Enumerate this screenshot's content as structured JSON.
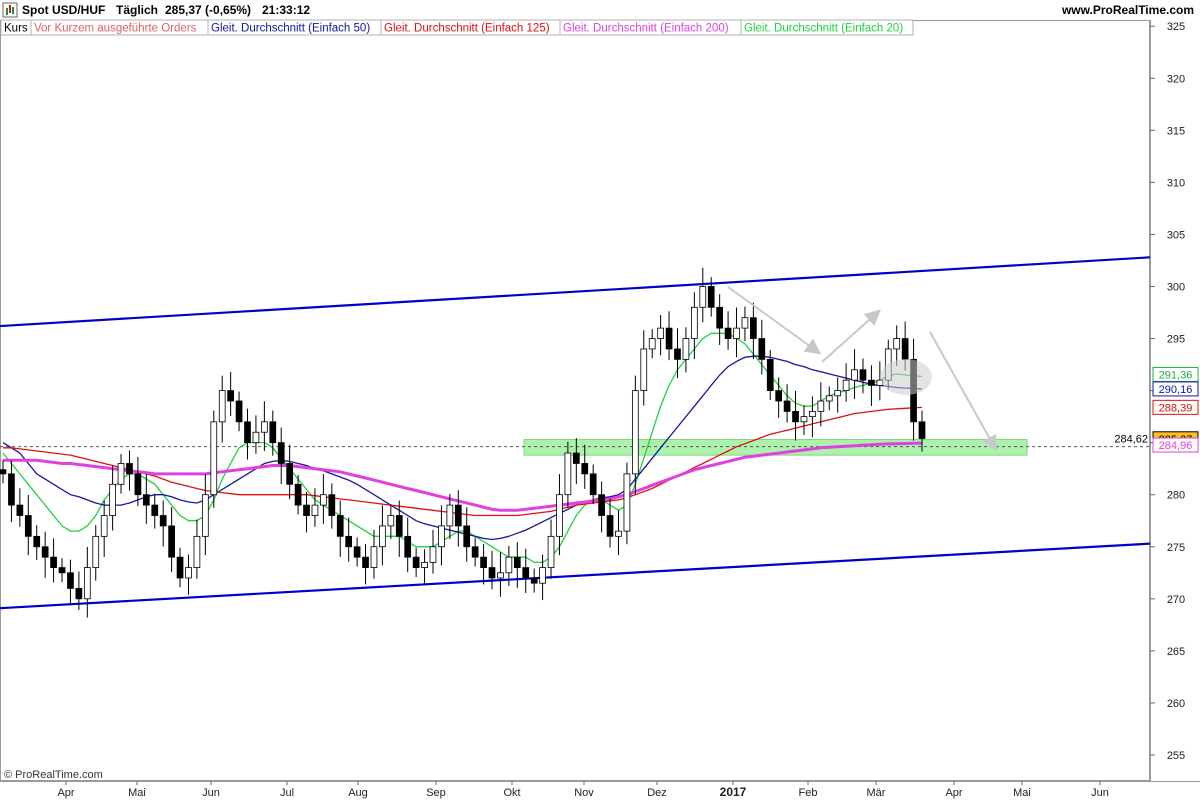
{
  "header": {
    "title": "Spot USD/HUF",
    "period": "Täglich",
    "quote": "285,37 (-0,65%)",
    "time": "21:33:12",
    "site": "www.ProRealTime.com"
  },
  "legend": [
    {
      "label": "Kurs",
      "color": "#000000"
    },
    {
      "label": "Vor Kurzem ausgeführte Orders",
      "color": "#e06060"
    },
    {
      "label": "Gleit. Durchschnitt (Einfach 50)",
      "color": "#1515a0"
    },
    {
      "label": "Gleit. Durchschnitt (Einfach 125)",
      "color": "#e01010"
    },
    {
      "label": "Gleit. Durchschnitt (Einfach 200)",
      "color": "#e040e0"
    },
    {
      "label": "Gleit. Durchschnitt (Einfach 20)",
      "color": "#20d040"
    }
  ],
  "copyright": "© ProRealTime.com",
  "price_labels": [
    {
      "value": "291,36",
      "price": 291.36,
      "color": "#20b040",
      "bg": "#ffffff"
    },
    {
      "value": "290,16",
      "price": 290.16,
      "color": "#1515a0",
      "bg": "#ffffff"
    },
    {
      "value": "288,39",
      "price": 288.39,
      "color": "#e01010",
      "bg": "#ffffff"
    },
    {
      "value": "285,37",
      "price": 285.37,
      "color": "#000000",
      "bg": "#ffc020"
    },
    {
      "value": "284,96",
      "price": 284.96,
      "color": "#e040e0",
      "bg": "#ffffff"
    }
  ],
  "dashed_level": {
    "value": "284,62",
    "price": 284.62
  },
  "chart_data": {
    "type": "candlestick",
    "title": "Spot USD/HUF",
    "y_ticks": [
      255,
      260,
      265,
      270,
      275,
      280,
      285,
      290,
      295,
      300,
      305,
      310,
      315,
      320,
      325
    ],
    "ylim": [
      252.5,
      325.5
    ],
    "x_ticks": [
      "Apr",
      "Mai",
      "Jun",
      "Jul",
      "Aug",
      "Sep",
      "Okt",
      "Nov",
      "Dez",
      "2017",
      "Feb",
      "Mär",
      "Apr",
      "Mai",
      "Jun"
    ],
    "bold_x_tick": "2017",
    "grid": false,
    "close_series": [
      282,
      279,
      278,
      276,
      275,
      274,
      273,
      272.5,
      271,
      270,
      273,
      276,
      278,
      281,
      283,
      282,
      280,
      279,
      278,
      277,
      274,
      272,
      273,
      276,
      280,
      287,
      290,
      289,
      287,
      285,
      286,
      287,
      285,
      283,
      281,
      279,
      278,
      279,
      280,
      278,
      276,
      275,
      274,
      273,
      275,
      277,
      278,
      276,
      274,
      273,
      273.5,
      275,
      277,
      279,
      277,
      275,
      274,
      273,
      272,
      272.5,
      274,
      273,
      272,
      271.5,
      273,
      276,
      280,
      284,
      283,
      282,
      280,
      278,
      276,
      276.5,
      282,
      290,
      294,
      295,
      296,
      294,
      293,
      295,
      298,
      300,
      298,
      296,
      295,
      296,
      297,
      295,
      293,
      290,
      289,
      288,
      287,
      287.5,
      288,
      289,
      289.5,
      290,
      291,
      292,
      291,
      290.5,
      291,
      294,
      295,
      293,
      287,
      285.4
    ],
    "ma_lines": [
      {
        "name": "Gleit. Durchschnitt (Einfach 20)",
        "color": "#20d040",
        "values": [
          284,
          283,
          282,
          281,
          280,
          279,
          278,
          277,
          276.5,
          276.5,
          277,
          278,
          279.5,
          280.5,
          281.5,
          282,
          282,
          281.5,
          281,
          280,
          279,
          278,
          277.5,
          277.5,
          278,
          279.5,
          281.5,
          283,
          284.5,
          285,
          285,
          285,
          284.5,
          283.5,
          282.5,
          281.5,
          280.5,
          279.5,
          279,
          278.5,
          278,
          277.5,
          277,
          276.5,
          276,
          276,
          276,
          276,
          275.5,
          275,
          275,
          275,
          275.5,
          276,
          276.5,
          276.5,
          276,
          275.5,
          275,
          274.5,
          274,
          274,
          274,
          273.5,
          273.5,
          274,
          275,
          276.5,
          278,
          279,
          279.5,
          279.5,
          279,
          278.5,
          279,
          281,
          283.5,
          286,
          288.5,
          290.5,
          292,
          293,
          294,
          295,
          295.5,
          295.5,
          295.5,
          295,
          294.5,
          293.5,
          292.5,
          291.5,
          290.5,
          289.5,
          288.8,
          288.5,
          288.5,
          289,
          289.5,
          289.8,
          290,
          290.3,
          290.5,
          290.7,
          291,
          291.4,
          291.6,
          291.5,
          291.4,
          291.36
        ]
      },
      {
        "name": "Gleit. Durchschnitt (Einfach 50)",
        "color": "#1515a0",
        "values": [
          285,
          284.5,
          284,
          283,
          282,
          281.5,
          281,
          280.5,
          280,
          279.8,
          279.5,
          279.2,
          279,
          279,
          279,
          279.2,
          279.5,
          279.8,
          280,
          280,
          279.8,
          279.5,
          279.3,
          279.2,
          279.5,
          280,
          280.5,
          281,
          281.5,
          282,
          282.5,
          283,
          283.2,
          283.3,
          283.2,
          283,
          282.8,
          282.5,
          282.3,
          282,
          281.7,
          281.4,
          281,
          280.5,
          280,
          279.5,
          279,
          278.5,
          278,
          277.5,
          277.2,
          277,
          276.8,
          276.6,
          276.4,
          276.2,
          276,
          275.8,
          275.7,
          275.8,
          276,
          276.3,
          276.6,
          277,
          277.4,
          277.8,
          278.2,
          278.6,
          279,
          279.3,
          279.5,
          279.7,
          279.8,
          280,
          280.5,
          281.5,
          282.5,
          283.5,
          284.5,
          285.5,
          286.5,
          287.5,
          288.5,
          289.5,
          290.5,
          291.5,
          292.3,
          292.8,
          293.2,
          293.3,
          293.3,
          293.2,
          293,
          292.8,
          292.5,
          292.3,
          292,
          291.8,
          291.6,
          291.4,
          291.2,
          291,
          290.8,
          290.6,
          290.5,
          290.4,
          290.3,
          290.25,
          290.2,
          290.16
        ]
      },
      {
        "name": "Gleit. Durchschnitt (Einfach 125)",
        "color": "#e01010",
        "values": [
          284.5,
          284.5,
          284.4,
          284.3,
          284.2,
          284.1,
          284,
          283.9,
          283.8,
          283.6,
          283.4,
          283.2,
          283,
          282.8,
          282.6,
          282.4,
          282.2,
          282,
          281.8,
          281.5,
          281.2,
          281,
          280.8,
          280.6,
          280.4,
          280.3,
          280.2,
          280.1,
          280,
          280,
          280,
          280,
          280,
          280,
          280,
          280,
          280,
          279.9,
          279.8,
          279.7,
          279.6,
          279.5,
          279.4,
          279.3,
          279.2,
          279.1,
          279,
          278.9,
          278.8,
          278.7,
          278.6,
          278.5,
          278.4,
          278.3,
          278.2,
          278.1,
          278,
          278,
          278,
          278,
          278,
          278,
          278.1,
          278.2,
          278.3,
          278.4,
          278.6,
          278.8,
          279,
          279.1,
          279.2,
          279.3,
          279.4,
          279.5,
          279.7,
          280,
          280.3,
          280.6,
          281,
          281.4,
          281.8,
          282.2,
          282.6,
          283,
          283.4,
          283.8,
          284.2,
          284.6,
          284.9,
          285.2,
          285.5,
          285.8,
          286,
          286.2,
          286.4,
          286.6,
          286.8,
          287,
          287.2,
          287.4,
          287.6,
          287.8,
          287.9,
          288,
          288.1,
          288.2,
          288.25,
          288.3,
          288.35,
          288.39
        ]
      },
      {
        "name": "Gleit. Durchschnitt (Einfach 200)",
        "color": "#e040e0",
        "values": [
          283.3,
          283.3,
          283.3,
          283.3,
          283.3,
          283.2,
          283.1,
          283,
          283,
          282.9,
          282.8,
          282.7,
          282.6,
          282.5,
          282.4,
          282.3,
          282.2,
          282.1,
          282,
          282,
          282,
          282,
          282,
          282,
          282,
          282.1,
          282.2,
          282.3,
          282.4,
          282.5,
          282.6,
          282.7,
          282.8,
          282.8,
          282.8,
          282.7,
          282.6,
          282.5,
          282.4,
          282.3,
          282.2,
          282,
          281.8,
          281.6,
          281.4,
          281.2,
          281,
          280.8,
          280.6,
          280.4,
          280.2,
          280,
          279.8,
          279.6,
          279.4,
          279.2,
          279,
          278.8,
          278.6,
          278.5,
          278.5,
          278.5,
          278.6,
          278.7,
          278.8,
          278.9,
          279,
          279.1,
          279.2,
          279.3,
          279.4,
          279.5,
          279.6,
          279.8,
          280,
          280.3,
          280.6,
          280.9,
          281.2,
          281.5,
          281.8,
          282.1,
          282.4,
          282.6,
          282.8,
          283,
          283.2,
          283.4,
          283.6,
          283.7,
          283.8,
          283.9,
          284,
          284.1,
          284.2,
          284.3,
          284.4,
          284.5,
          284.55,
          284.6,
          284.65,
          284.7,
          284.75,
          284.8,
          284.85,
          284.88,
          284.9,
          284.92,
          284.94,
          284.96
        ]
      }
    ],
    "trend_lines": [
      {
        "name": "upper-channel",
        "color": "#0000cc",
        "from": {
          "x_frac": 0,
          "y": 296.2
        },
        "to": {
          "x_frac": 1,
          "y": 302.8
        }
      },
      {
        "name": "lower-channel",
        "color": "#0000cc",
        "from": {
          "x_frac": 0,
          "y": 269.1
        },
        "to": {
          "x_frac": 1,
          "y": 275.3
        }
      }
    ],
    "support_zone": {
      "y_low": 283.8,
      "y_high": 285.3,
      "color": "#90ee90"
    }
  }
}
